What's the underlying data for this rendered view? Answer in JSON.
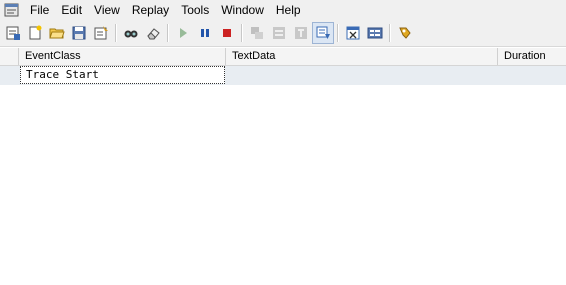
{
  "menu": {
    "items": [
      "File",
      "Edit",
      "View",
      "Replay",
      "Tools",
      "Window",
      "Help"
    ]
  },
  "toolbar": {
    "buttons": [
      {
        "icon": "properties-icon"
      },
      {
        "icon": "new-trace-icon"
      },
      {
        "icon": "open-file-icon"
      },
      {
        "icon": "save-icon"
      },
      {
        "icon": "properties-edit-icon"
      },
      {
        "icon": "find-icon"
      },
      {
        "icon": "clear-icon"
      },
      {
        "icon": "play-icon"
      },
      {
        "icon": "pause-icon"
      },
      {
        "icon": "stop-icon"
      },
      {
        "icon": "group-events-icon"
      },
      {
        "icon": "aggregate-icon"
      },
      {
        "icon": "text-view-icon"
      },
      {
        "icon": "auto-scroll-icon"
      },
      {
        "icon": "clear-window-icon"
      },
      {
        "icon": "display-icon"
      },
      {
        "icon": "help-icon"
      }
    ]
  },
  "grid": {
    "columns": [
      "EventClass",
      "TextData",
      "Duration"
    ],
    "rows": [
      {
        "event_class": "Trace Start",
        "text_data": "",
        "duration": ""
      }
    ]
  },
  "colors": {
    "stop": "#cc2222",
    "pause": "#2255aa",
    "play": "#2e7d32",
    "row_bg": "#e8edf2",
    "header_bg": "#f4f4f4"
  }
}
